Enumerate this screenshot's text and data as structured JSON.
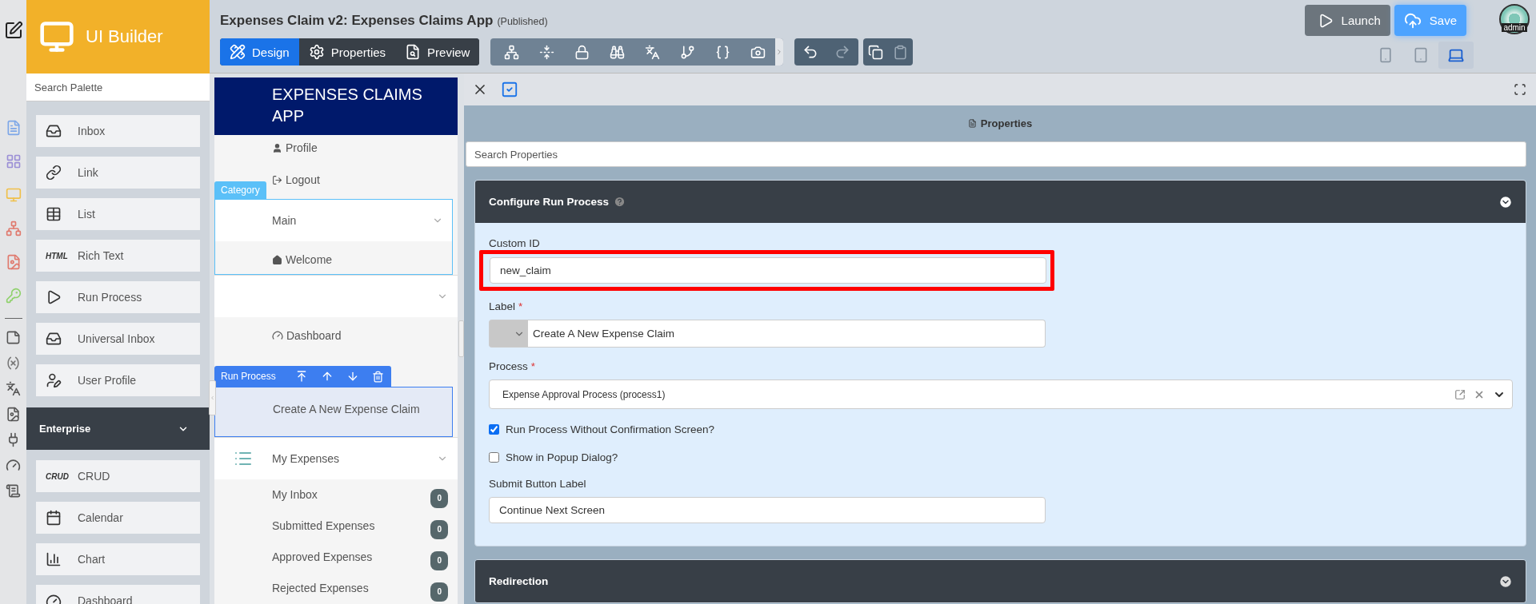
{
  "brand": {
    "title": "UI Builder"
  },
  "palette": {
    "search": {
      "placeholder": "Search Palette"
    },
    "items": [
      {
        "label": "Inbox"
      },
      {
        "label": "Link"
      },
      {
        "label": "List"
      },
      {
        "label": "Rich Text",
        "icon_text": "HTML"
      },
      {
        "label": "Run Process"
      },
      {
        "label": "Universal Inbox"
      },
      {
        "label": "User Profile"
      }
    ],
    "sections": [
      {
        "title": "Enterprise",
        "expanded": true,
        "items": [
          {
            "label": "CRUD",
            "icon_text": "CRUD"
          },
          {
            "label": "Calendar"
          },
          {
            "label": "Chart"
          },
          {
            "label": "Dashboard"
          }
        ]
      }
    ]
  },
  "header": {
    "title": "Expenses Claim v2: Expenses Claims App",
    "status": "(Published)",
    "tabs": [
      {
        "label": "Design",
        "selected": true
      },
      {
        "label": "Properties",
        "selected": false
      },
      {
        "label": "Preview",
        "selected": false
      }
    ],
    "launch": "Launch",
    "save": "Save",
    "avatar": "admin",
    "devices": [
      {
        "selected": false
      },
      {
        "selected": false
      },
      {
        "selected": true
      }
    ]
  },
  "canvas": {
    "app_title": "EXPENSES CLAIMS APP",
    "user_menu": [
      {
        "label": "Profile"
      },
      {
        "label": "Logout"
      }
    ],
    "categories": [
      {
        "label": "Main",
        "tag": "Category",
        "selected": true,
        "items": [
          {
            "label": "Welcome",
            "kind": "home"
          }
        ]
      },
      {
        "selected": false,
        "items": [
          {
            "label": "Dashboard",
            "kind": "dashboard"
          },
          {
            "label": "Create A New Expense Claim",
            "kind": "process",
            "tag": "Run Process",
            "selected": true
          }
        ]
      },
      {
        "label": "My Expenses",
        "selected": false,
        "items": [
          {
            "label": "My Inbox",
            "count": "0",
            "kind": "inbox"
          },
          {
            "label": "Submitted Expenses",
            "count": "0",
            "kind": "inbox"
          },
          {
            "label": "Approved Expenses",
            "count": "0",
            "kind": "inbox"
          },
          {
            "label": "Rejected Expenses",
            "count": "0",
            "kind": "inbox"
          }
        ]
      }
    ]
  },
  "properties": {
    "title": "Properties",
    "search": {
      "placeholder": "Search Properties"
    },
    "sections": [
      {
        "title": "Configure Run Process",
        "expanded": true,
        "fields": [
          {
            "kind": "text",
            "label": "Custom ID",
            "value": "new_claim",
            "highlighted": true
          },
          {
            "kind": "label",
            "label": "Label",
            "required_mark": "*",
            "value": "Create A New Expense Claim"
          },
          {
            "kind": "select",
            "label": "Process",
            "required_mark": "*",
            "value": "Expense Approval Process (process1)"
          },
          {
            "kind": "checkbox",
            "label": "Run Process Without Confirmation Screen?",
            "checked": true
          },
          {
            "kind": "checkbox",
            "label": "Show in Popup Dialog?",
            "checked": false
          },
          {
            "kind": "text",
            "label": "Submit Button Label",
            "value": "Continue Next Screen"
          }
        ]
      },
      {
        "title": "Redirection",
        "expanded": false
      }
    ]
  }
}
